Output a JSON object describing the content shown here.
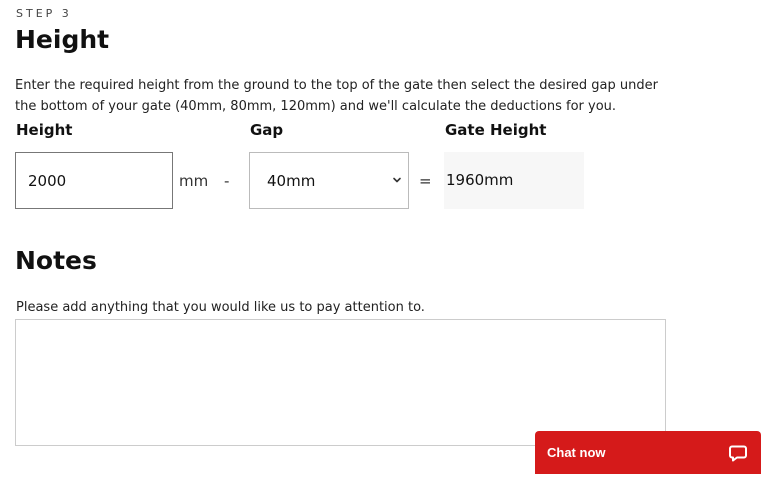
{
  "step": {
    "label": "STEP 3",
    "title": "Height",
    "description": "Enter the required height from the ground to the top of the gate then select the desired gap under the bottom of your gate (40mm, 80mm, 120mm) and we'll calculate the deductions for you."
  },
  "height_field": {
    "label": "Height",
    "value": "2000",
    "unit": "mm"
  },
  "operators": {
    "minus": "-",
    "equals": "="
  },
  "gap_field": {
    "label": "Gap",
    "selected": "40mm"
  },
  "gate_height": {
    "label": "Gate Height",
    "value": "1960mm"
  },
  "notes": {
    "title": "Notes",
    "help_text": "Please add anything that you would like us to pay attention to.",
    "value": ""
  },
  "chat": {
    "label": "Chat now",
    "color": "#d51a1a"
  },
  "icons": {
    "gap_dropdown": "chevron-down-icon",
    "chat": "chat-bubble-icon"
  }
}
